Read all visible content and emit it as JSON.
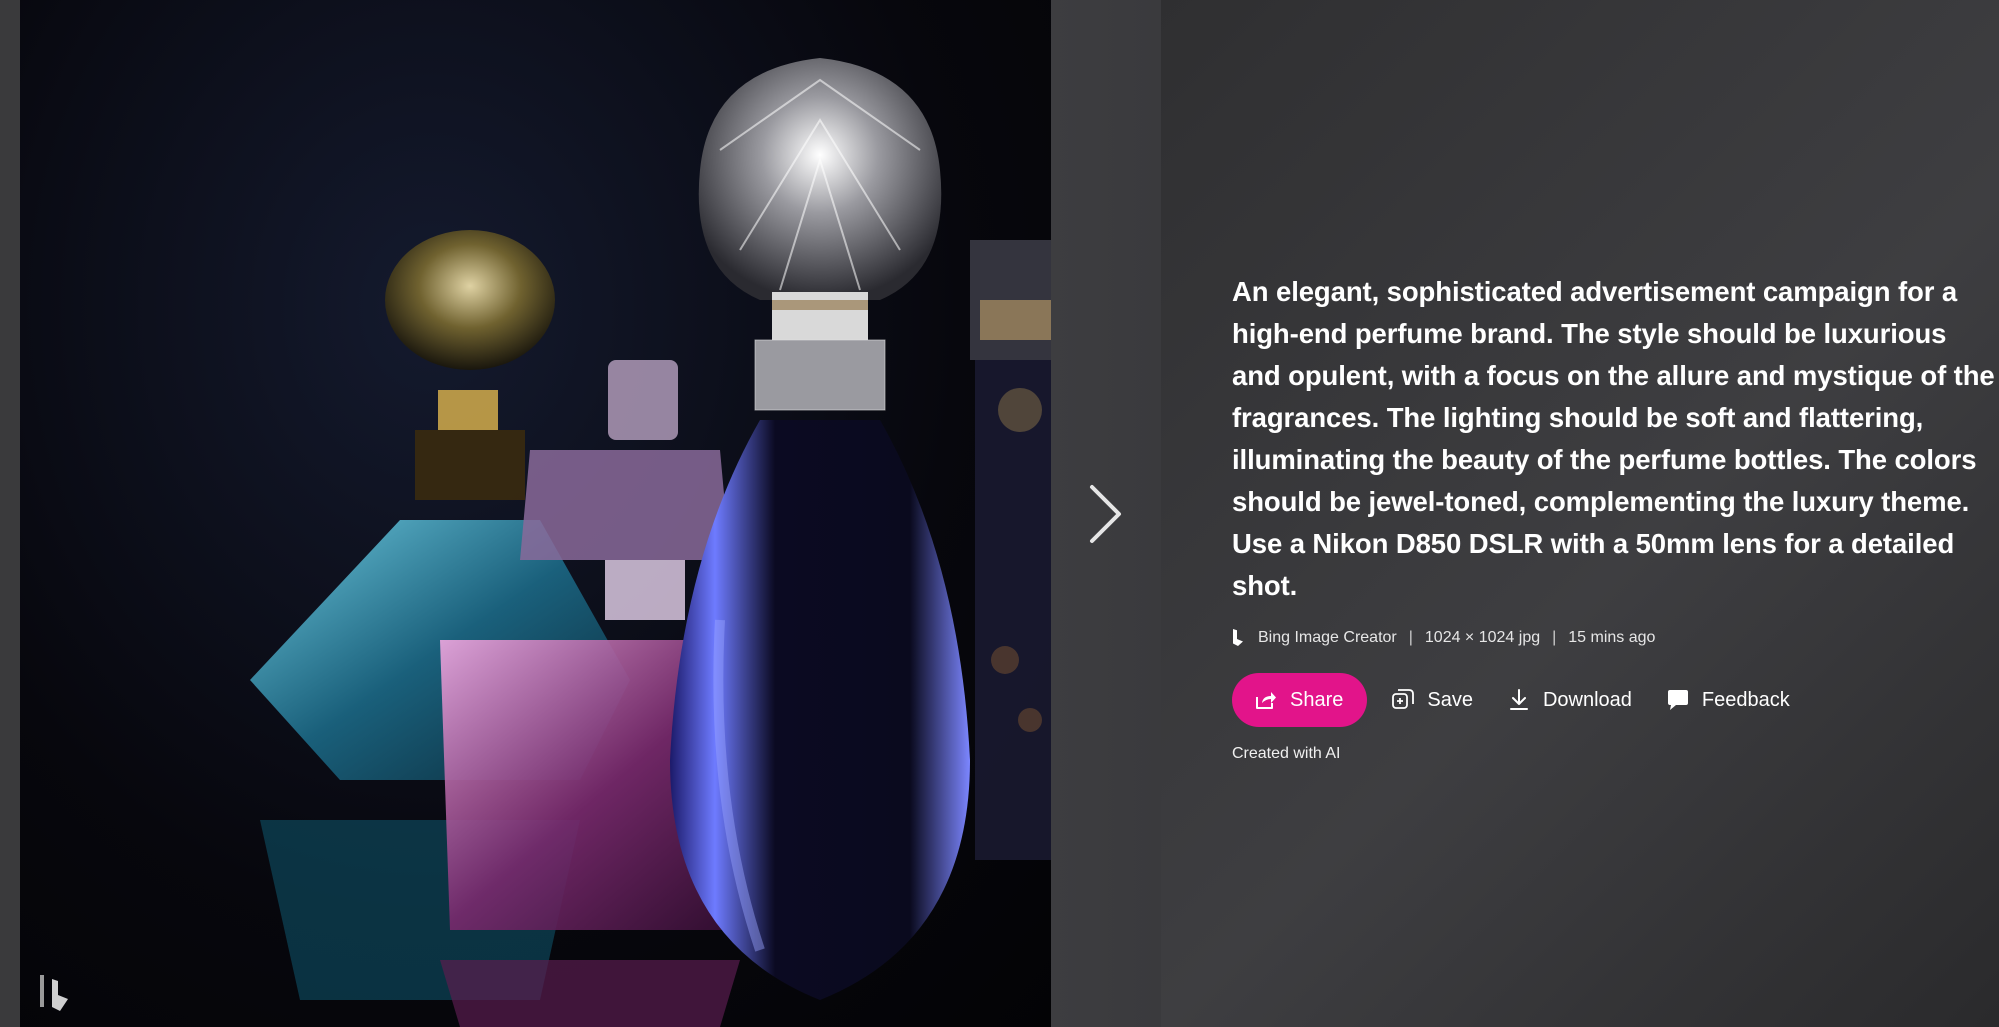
{
  "image": {
    "alt": "",
    "watermark_icon": "bing-logo-icon"
  },
  "navigation": {
    "next_icon": "chevron-right-icon"
  },
  "details": {
    "prompt": "An elegant, sophisticated advertisement campaign for a high-end perfume brand. The style should be luxurious and opulent, with a focus on the allure and mystique of the fragrances. The lighting should be soft and flattering, illuminating the beauty of the perfume bottles. The colors should be jewel-toned, complementing the luxury theme. Use a Nikon D850 DSLR with a 50mm lens for a detailed shot.",
    "source": "Bing Image Creator",
    "separator": "|",
    "dimensions": "1024 × 1024 jpg",
    "time_ago": "15 mins ago",
    "created_label": "Created with AI"
  },
  "actions": {
    "share_label": "Share",
    "save_label": "Save",
    "download_label": "Download",
    "feedback_label": "Feedback"
  },
  "colors": {
    "share_button": "#e2148a",
    "panel_background": "#38383b"
  }
}
